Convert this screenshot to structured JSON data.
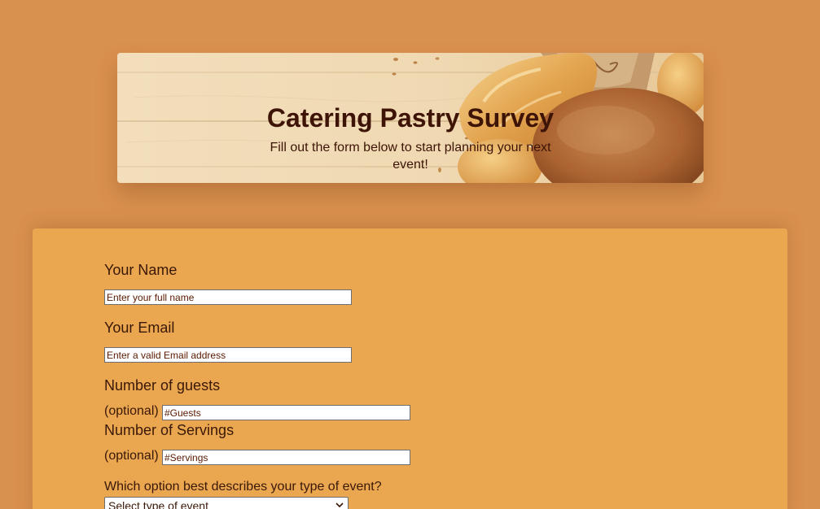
{
  "header": {
    "title": "Catering Pastry Survey",
    "subtitle": "Fill out the form below to start planning your next event!"
  },
  "form": {
    "name": {
      "label": "Your Name",
      "placeholder": "Enter your full name",
      "value": ""
    },
    "email": {
      "label": "Your Email",
      "placeholder": "Enter a valid Email address",
      "value": ""
    },
    "guests": {
      "label": "Number of guests",
      "optional_label": "(optional)",
      "placeholder": "#Guests",
      "value": ""
    },
    "servings": {
      "label": "Number of Servings",
      "optional_label": "(optional)",
      "placeholder": "#Servings",
      "value": ""
    },
    "event_type": {
      "label": "Which option best describes your type of event?",
      "selected": "Select type of event"
    }
  },
  "colors": {
    "page_background": "#d9914f",
    "card_background": "#eaa74f",
    "text": "#3a1808",
    "title": "#3d1406"
  },
  "icons": {
    "select_arrow": "chevron-down-icon",
    "banner_image": "bread-photo"
  }
}
